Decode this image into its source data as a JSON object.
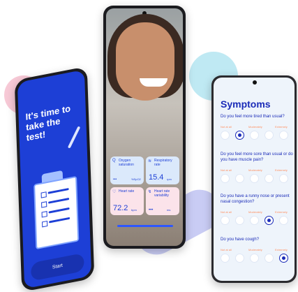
{
  "left_phone": {
    "headline": "It's time to take the test!",
    "start_button": "Start"
  },
  "middle_phone": {
    "tiles": [
      {
        "label": "Oxygen saturation",
        "value": "",
        "unit": "%SpO2"
      },
      {
        "label": "Respiratory rate",
        "value": "15.4",
        "unit": "rpm"
      },
      {
        "label": "Heart rate",
        "value": "72.2",
        "unit": "bpm"
      },
      {
        "label": "Heart rate variability",
        "value": "•••",
        "unit": "ms"
      }
    ]
  },
  "right_phone": {
    "title": "Symptoms",
    "scale": [
      "Not at all",
      "Moderately",
      "Extremely"
    ],
    "questions": [
      {
        "text": "Do you feel more tired than usual?",
        "selected": 1
      },
      {
        "text": "Do you feel more sore than usual or do you have muscle pain?",
        "selected": null
      },
      {
        "text": "Do you have a runny nose or present nasal congestion?",
        "selected": 3
      },
      {
        "text": "Do you have cough?",
        "selected": 4
      }
    ]
  },
  "colors": {
    "brand_blue": "#1d3fd6",
    "accent_orange": "#ff8f60",
    "pink": "#f7c9d6",
    "cyan": "#bfe9f3"
  }
}
